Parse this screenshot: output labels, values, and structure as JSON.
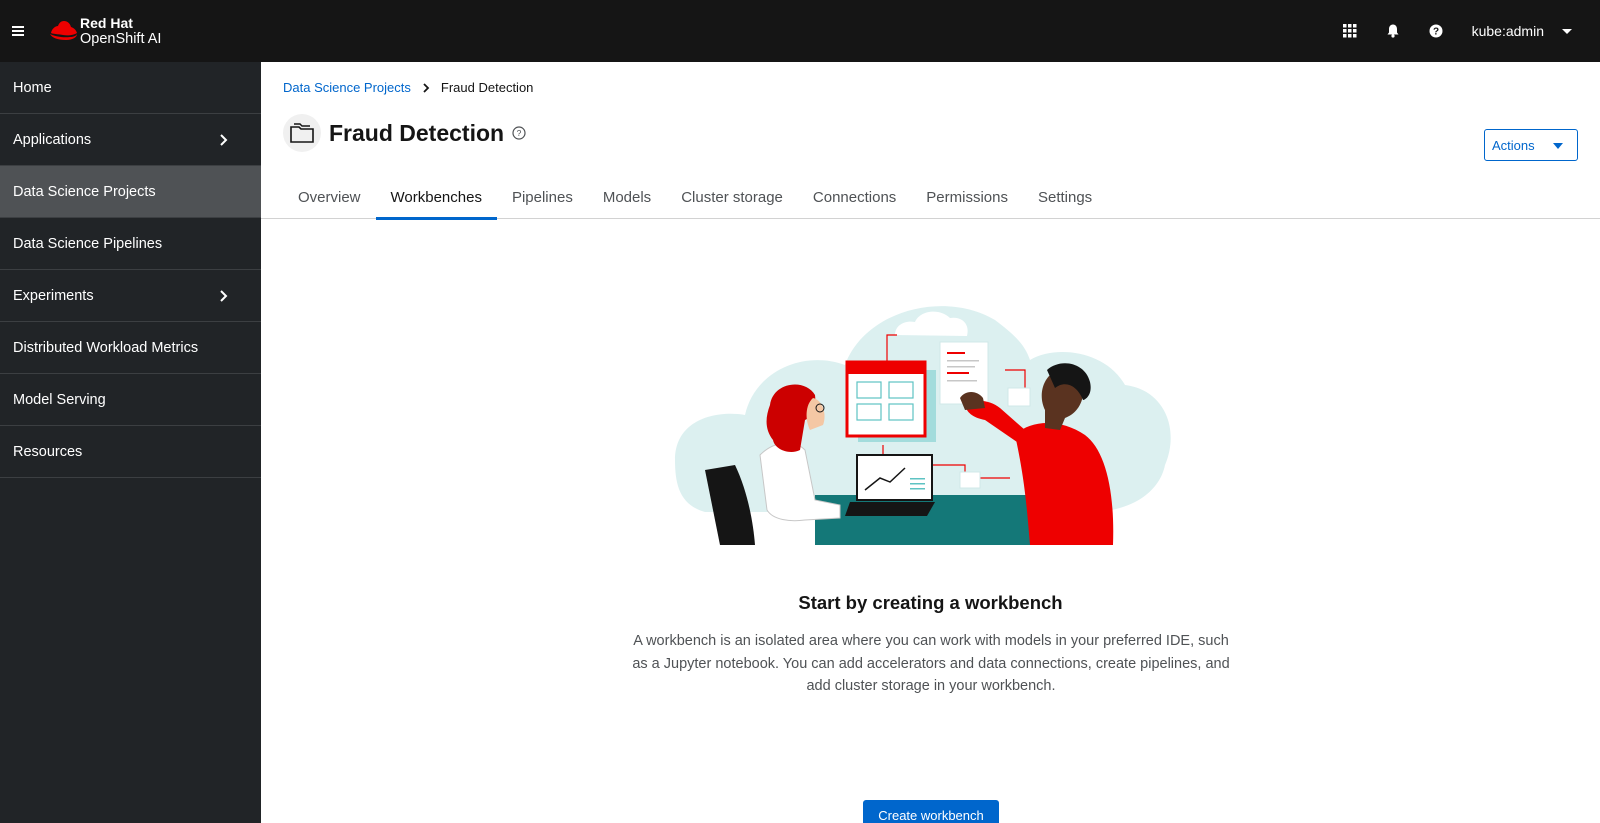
{
  "masthead": {
    "brand_top": "Red Hat",
    "brand_bottom": "OpenShift AI",
    "user": "kube:admin",
    "icons": [
      "hamburger-icon",
      "app-launcher-icon",
      "bell-icon",
      "help-icon",
      "caret-down-icon"
    ]
  },
  "sidebar": {
    "items": [
      {
        "label": "Home",
        "has_children": false,
        "active": false
      },
      {
        "label": "Applications",
        "has_children": true,
        "active": false
      },
      {
        "label": "Data Science Projects",
        "has_children": false,
        "active": true
      },
      {
        "label": "Data Science Pipelines",
        "has_children": false,
        "active": false
      },
      {
        "label": "Experiments",
        "has_children": true,
        "active": false
      },
      {
        "label": "Distributed Workload Metrics",
        "has_children": false,
        "active": false
      },
      {
        "label": "Model Serving",
        "has_children": false,
        "active": false
      },
      {
        "label": "Resources",
        "has_children": false,
        "active": false
      }
    ]
  },
  "breadcrumb": {
    "parent": "Data Science Projects",
    "current": "Fraud Detection"
  },
  "page": {
    "title": "Fraud Detection",
    "actions_label": "Actions"
  },
  "tabs": [
    {
      "label": "Overview",
      "active": false
    },
    {
      "label": "Workbenches",
      "active": true
    },
    {
      "label": "Pipelines",
      "active": false
    },
    {
      "label": "Models",
      "active": false
    },
    {
      "label": "Cluster storage",
      "active": false
    },
    {
      "label": "Connections",
      "active": false
    },
    {
      "label": "Permissions",
      "active": false
    },
    {
      "label": "Settings",
      "active": false
    }
  ],
  "empty_state": {
    "title": "Start by creating a workbench",
    "body": "A workbench is an isolated area where you can work with models in your preferred IDE, such as a Jupyter notebook. You can add accelerators and data connections, create pipelines, and add cluster storage in your workbench.",
    "button_label": "Create workbench"
  },
  "colors": {
    "masthead_bg": "#151515",
    "sidebar_bg": "#212427",
    "sidebar_active": "#4f5255",
    "accent": "#0066cc",
    "brand_red": "#ee0000"
  }
}
